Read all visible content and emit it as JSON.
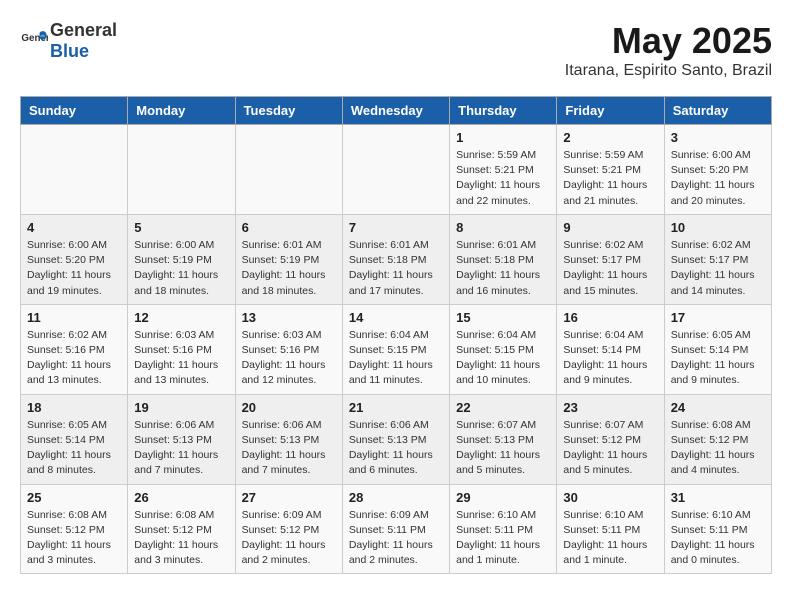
{
  "header": {
    "logo_general": "General",
    "logo_blue": "Blue",
    "title": "May 2025",
    "subtitle": "Itarana, Espirito Santo, Brazil"
  },
  "weekdays": [
    "Sunday",
    "Monday",
    "Tuesday",
    "Wednesday",
    "Thursday",
    "Friday",
    "Saturday"
  ],
  "weeks": [
    [
      {
        "day": "",
        "info": ""
      },
      {
        "day": "",
        "info": ""
      },
      {
        "day": "",
        "info": ""
      },
      {
        "day": "",
        "info": ""
      },
      {
        "day": "1",
        "info": "Sunrise: 5:59 AM\nSunset: 5:21 PM\nDaylight: 11 hours\nand 22 minutes."
      },
      {
        "day": "2",
        "info": "Sunrise: 5:59 AM\nSunset: 5:21 PM\nDaylight: 11 hours\nand 21 minutes."
      },
      {
        "day": "3",
        "info": "Sunrise: 6:00 AM\nSunset: 5:20 PM\nDaylight: 11 hours\nand 20 minutes."
      }
    ],
    [
      {
        "day": "4",
        "info": "Sunrise: 6:00 AM\nSunset: 5:20 PM\nDaylight: 11 hours\nand 19 minutes."
      },
      {
        "day": "5",
        "info": "Sunrise: 6:00 AM\nSunset: 5:19 PM\nDaylight: 11 hours\nand 18 minutes."
      },
      {
        "day": "6",
        "info": "Sunrise: 6:01 AM\nSunset: 5:19 PM\nDaylight: 11 hours\nand 18 minutes."
      },
      {
        "day": "7",
        "info": "Sunrise: 6:01 AM\nSunset: 5:18 PM\nDaylight: 11 hours\nand 17 minutes."
      },
      {
        "day": "8",
        "info": "Sunrise: 6:01 AM\nSunset: 5:18 PM\nDaylight: 11 hours\nand 16 minutes."
      },
      {
        "day": "9",
        "info": "Sunrise: 6:02 AM\nSunset: 5:17 PM\nDaylight: 11 hours\nand 15 minutes."
      },
      {
        "day": "10",
        "info": "Sunrise: 6:02 AM\nSunset: 5:17 PM\nDaylight: 11 hours\nand 14 minutes."
      }
    ],
    [
      {
        "day": "11",
        "info": "Sunrise: 6:02 AM\nSunset: 5:16 PM\nDaylight: 11 hours\nand 13 minutes."
      },
      {
        "day": "12",
        "info": "Sunrise: 6:03 AM\nSunset: 5:16 PM\nDaylight: 11 hours\nand 13 minutes."
      },
      {
        "day": "13",
        "info": "Sunrise: 6:03 AM\nSunset: 5:16 PM\nDaylight: 11 hours\nand 12 minutes."
      },
      {
        "day": "14",
        "info": "Sunrise: 6:04 AM\nSunset: 5:15 PM\nDaylight: 11 hours\nand 11 minutes."
      },
      {
        "day": "15",
        "info": "Sunrise: 6:04 AM\nSunset: 5:15 PM\nDaylight: 11 hours\nand 10 minutes."
      },
      {
        "day": "16",
        "info": "Sunrise: 6:04 AM\nSunset: 5:14 PM\nDaylight: 11 hours\nand 9 minutes."
      },
      {
        "day": "17",
        "info": "Sunrise: 6:05 AM\nSunset: 5:14 PM\nDaylight: 11 hours\nand 9 minutes."
      }
    ],
    [
      {
        "day": "18",
        "info": "Sunrise: 6:05 AM\nSunset: 5:14 PM\nDaylight: 11 hours\nand 8 minutes."
      },
      {
        "day": "19",
        "info": "Sunrise: 6:06 AM\nSunset: 5:13 PM\nDaylight: 11 hours\nand 7 minutes."
      },
      {
        "day": "20",
        "info": "Sunrise: 6:06 AM\nSunset: 5:13 PM\nDaylight: 11 hours\nand 7 minutes."
      },
      {
        "day": "21",
        "info": "Sunrise: 6:06 AM\nSunset: 5:13 PM\nDaylight: 11 hours\nand 6 minutes."
      },
      {
        "day": "22",
        "info": "Sunrise: 6:07 AM\nSunset: 5:13 PM\nDaylight: 11 hours\nand 5 minutes."
      },
      {
        "day": "23",
        "info": "Sunrise: 6:07 AM\nSunset: 5:12 PM\nDaylight: 11 hours\nand 5 minutes."
      },
      {
        "day": "24",
        "info": "Sunrise: 6:08 AM\nSunset: 5:12 PM\nDaylight: 11 hours\nand 4 minutes."
      }
    ],
    [
      {
        "day": "25",
        "info": "Sunrise: 6:08 AM\nSunset: 5:12 PM\nDaylight: 11 hours\nand 3 minutes."
      },
      {
        "day": "26",
        "info": "Sunrise: 6:08 AM\nSunset: 5:12 PM\nDaylight: 11 hours\nand 3 minutes."
      },
      {
        "day": "27",
        "info": "Sunrise: 6:09 AM\nSunset: 5:12 PM\nDaylight: 11 hours\nand 2 minutes."
      },
      {
        "day": "28",
        "info": "Sunrise: 6:09 AM\nSunset: 5:11 PM\nDaylight: 11 hours\nand 2 minutes."
      },
      {
        "day": "29",
        "info": "Sunrise: 6:10 AM\nSunset: 5:11 PM\nDaylight: 11 hours\nand 1 minute."
      },
      {
        "day": "30",
        "info": "Sunrise: 6:10 AM\nSunset: 5:11 PM\nDaylight: 11 hours\nand 1 minute."
      },
      {
        "day": "31",
        "info": "Sunrise: 6:10 AM\nSunset: 5:11 PM\nDaylight: 11 hours\nand 0 minutes."
      }
    ]
  ]
}
